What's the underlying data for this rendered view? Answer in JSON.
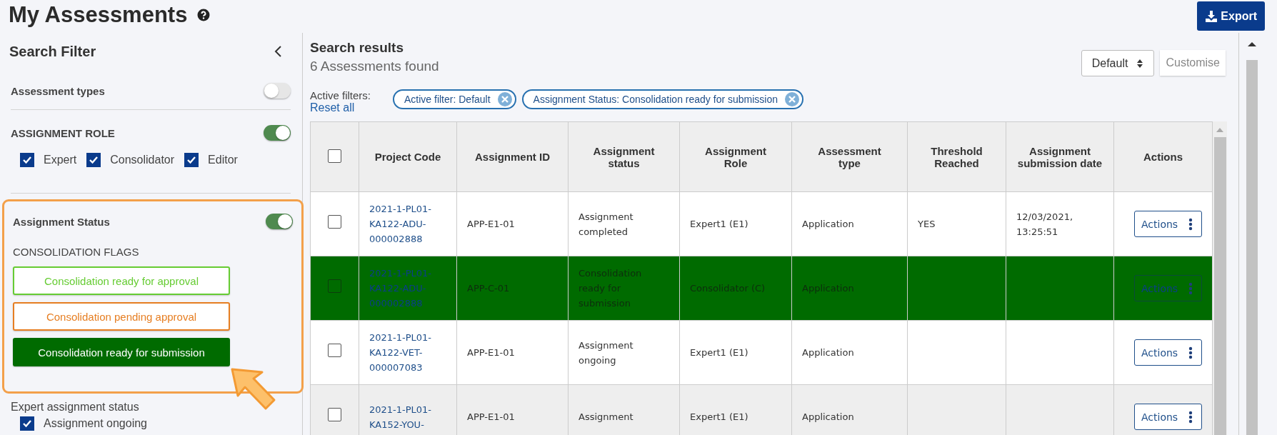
{
  "page": {
    "title": "My Assessments",
    "export_label": "Export"
  },
  "filter": {
    "title": "Search Filter",
    "assessment_types": {
      "label": "Assessment types",
      "on": false
    },
    "assignment_role": {
      "label": "ASSIGNMENT ROLE",
      "on": true,
      "options": [
        {
          "label": "Expert",
          "checked": true
        },
        {
          "label": "Consolidator",
          "checked": true
        },
        {
          "label": "Editor",
          "checked": true
        }
      ]
    },
    "assignment_status": {
      "label": "Assignment Status",
      "on": true,
      "subheading": "CONSOLIDATION FLAGS",
      "flags": [
        {
          "label": "Consolidation ready for approval",
          "color": "#66cc33",
          "selected": false
        },
        {
          "label": "Consolidation pending approval",
          "color": "#e67e22",
          "selected": false
        },
        {
          "label": "Consolidation ready for submission",
          "color": "#006b00",
          "selected": true
        }
      ]
    },
    "expert_status": {
      "label": "Expert assignment status",
      "options": [
        {
          "label": "Assignment ongoing",
          "checked": true
        }
      ]
    }
  },
  "results": {
    "title": "Search results",
    "count": "6 Assessments found",
    "view": "Default",
    "customise": "Customise",
    "active_filters_label": "Active filters:",
    "reset_all": "Reset all",
    "chips": [
      "Active filter: Default",
      "Assignment Status: Consolidation ready for submission"
    ]
  },
  "table": {
    "all_checked": false,
    "columns": [
      "Project Code",
      "Assignment ID",
      "Assignment status",
      "Assignment Role",
      "Assessment type",
      "Threshold Reached",
      "Assignment submission date",
      "Actions"
    ],
    "rows": [
      {
        "checked": false,
        "selected": false,
        "project_code": "2021-1-PL01-KA122-ADU-000002888",
        "assignment_id": "APP-E1-01",
        "status": "Assignment completed",
        "role": "Expert1 (E1)",
        "type": "Application",
        "threshold": "YES",
        "date": "12/03/2021, 13:25:51",
        "action": "Actions"
      },
      {
        "checked": false,
        "selected": true,
        "project_code": "2021-1-PL01-KA122-ADU-000002888",
        "assignment_id": "APP-C-01",
        "status": "Consolidation ready for submission",
        "role": "Consolidator (C)",
        "type": "Application",
        "threshold": "",
        "date": "",
        "action": "Actions"
      },
      {
        "checked": false,
        "selected": false,
        "project_code": "2021-1-PL01-KA122-VET-000007083",
        "assignment_id": "APP-E1-01",
        "status": "Assignment ongoing",
        "role": "Expert1 (E1)",
        "type": "Application",
        "threshold": "",
        "date": "",
        "action": "Actions"
      },
      {
        "checked": false,
        "selected": false,
        "project_code": "2021-1-PL01-KA152-YOU-",
        "assignment_id": "APP-E1-01",
        "status": "Assignment",
        "role": "Expert1 (E1)",
        "type": "Application",
        "threshold": "",
        "date": "",
        "action": "Actions"
      }
    ]
  }
}
